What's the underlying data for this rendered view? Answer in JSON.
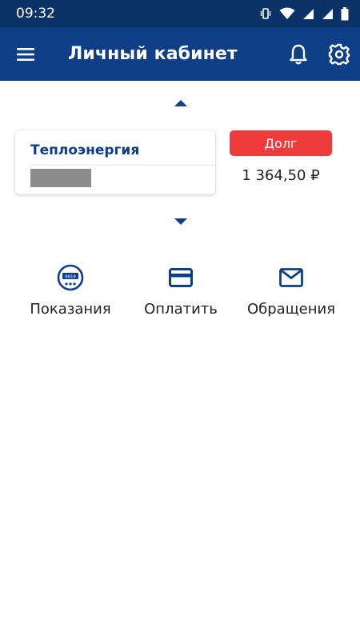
{
  "status_bar": {
    "time": "09:32",
    "icons": [
      "vibrate-icon",
      "wifi-icon",
      "signal-icon",
      "signal-icon",
      "battery-icon"
    ]
  },
  "app_bar": {
    "title": "Личный кабинет",
    "icons": [
      "menu-icon",
      "bell-icon",
      "gear-icon"
    ]
  },
  "account": {
    "name": "Теплоэнергия",
    "debt_label": "Долг",
    "debt_amount": "1 364,50 ₽"
  },
  "actions": [
    {
      "label": "Показания",
      "icon": "meter-icon",
      "meter_text": "0019"
    },
    {
      "label": "Оплатить",
      "icon": "card-icon"
    },
    {
      "label": "Обращения",
      "icon": "mail-icon"
    }
  ],
  "colors": {
    "status_bar": "#0b3266",
    "app_bar": "#0e3f86",
    "accent": "#0e3f86",
    "debt": "#ef3b3b"
  }
}
